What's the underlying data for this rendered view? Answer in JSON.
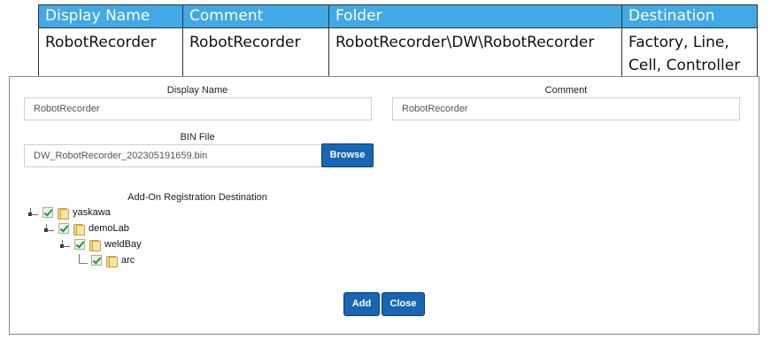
{
  "summary_table": {
    "headers": [
      "Display Name",
      "Comment",
      "Folder",
      "Destination"
    ],
    "row": {
      "display_name": "RobotRecorder",
      "comment": "RobotRecorder",
      "folder": "RobotRecorder\\DW\\RobotRecorder",
      "destination_line1": "Factory, Line,",
      "destination_line2": "Cell, Controller"
    },
    "header_color": "#40a9e6"
  },
  "form": {
    "display_name_label": "Display Name",
    "display_name_value": "RobotRecorder",
    "comment_label": "Comment",
    "comment_value": "RobotRecorder",
    "bin_file_label": "BIN File",
    "bin_file_value": "DW_RobotRecorder_202305191659.bin",
    "browse_label": "Browse",
    "destination_label": "Add-On Registration Destination"
  },
  "tree": {
    "nodes": [
      {
        "label": "yaskawa",
        "checked": true,
        "icon": "folder-icon"
      },
      {
        "label": "demoLab",
        "checked": true,
        "icon": "folder-icon"
      },
      {
        "label": "weldBay",
        "checked": true,
        "icon": "folder-icon"
      },
      {
        "label": "arc",
        "checked": true,
        "icon": "folder-icon"
      }
    ]
  },
  "actions": {
    "add_label": "Add",
    "close_label": "Close"
  },
  "colors": {
    "button_blue": "#1766b4",
    "check_green": "#1f9b2c"
  }
}
